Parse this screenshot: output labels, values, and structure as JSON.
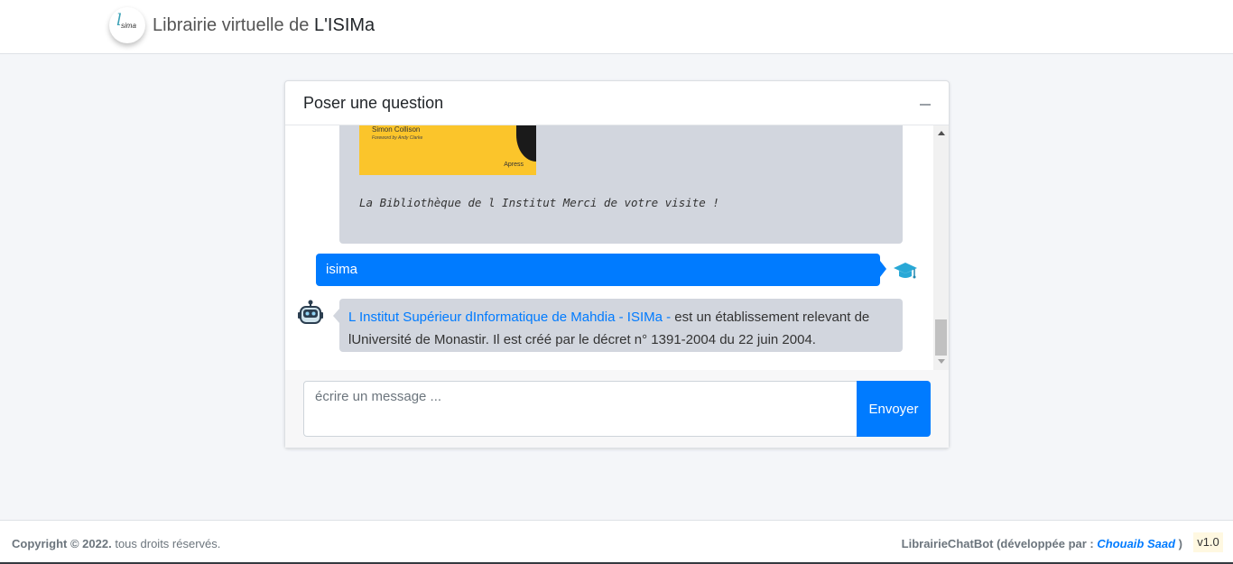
{
  "header": {
    "logo_text": "sima",
    "brand_prefix": "Librairie virtuelle de ",
    "brand_strong": "L'ISIMa"
  },
  "chat_card": {
    "title": "Poser une question",
    "collapse_icon": "minus-icon"
  },
  "messages": {
    "book": {
      "author": "Simon Collison",
      "foreword": "Foreword by Andy Clarke",
      "publisher": "Apress"
    },
    "bot_1_text": "La Bibliothèque de l Institut Merci de votre visite !",
    "user_text": "isima",
    "bot_2_link": "L Institut Supérieur dInformatique de Mahdia - ISIMa -",
    "bot_2_text": " est un établissement relevant de lUniversité de Monastir. Il est créé par le décret n° 1391-2004 du 22 juin 2004."
  },
  "input": {
    "placeholder": "écrire un message ...",
    "send_label": "Envoyer"
  },
  "footer": {
    "copyright_strong": "Copyright © 2022.",
    "copyright_rest": " tous droits réservés.",
    "app_name": "LibrairieChatBot",
    "dev_prefix": " (développée par : ",
    "dev_name": "Chouaib Saad",
    "dev_suffix": " )",
    "version": "v1.0"
  },
  "colors": {
    "primary": "#007bff",
    "bubble_bot": "#d2d6de",
    "book_yellow": "#fbc52b"
  }
}
